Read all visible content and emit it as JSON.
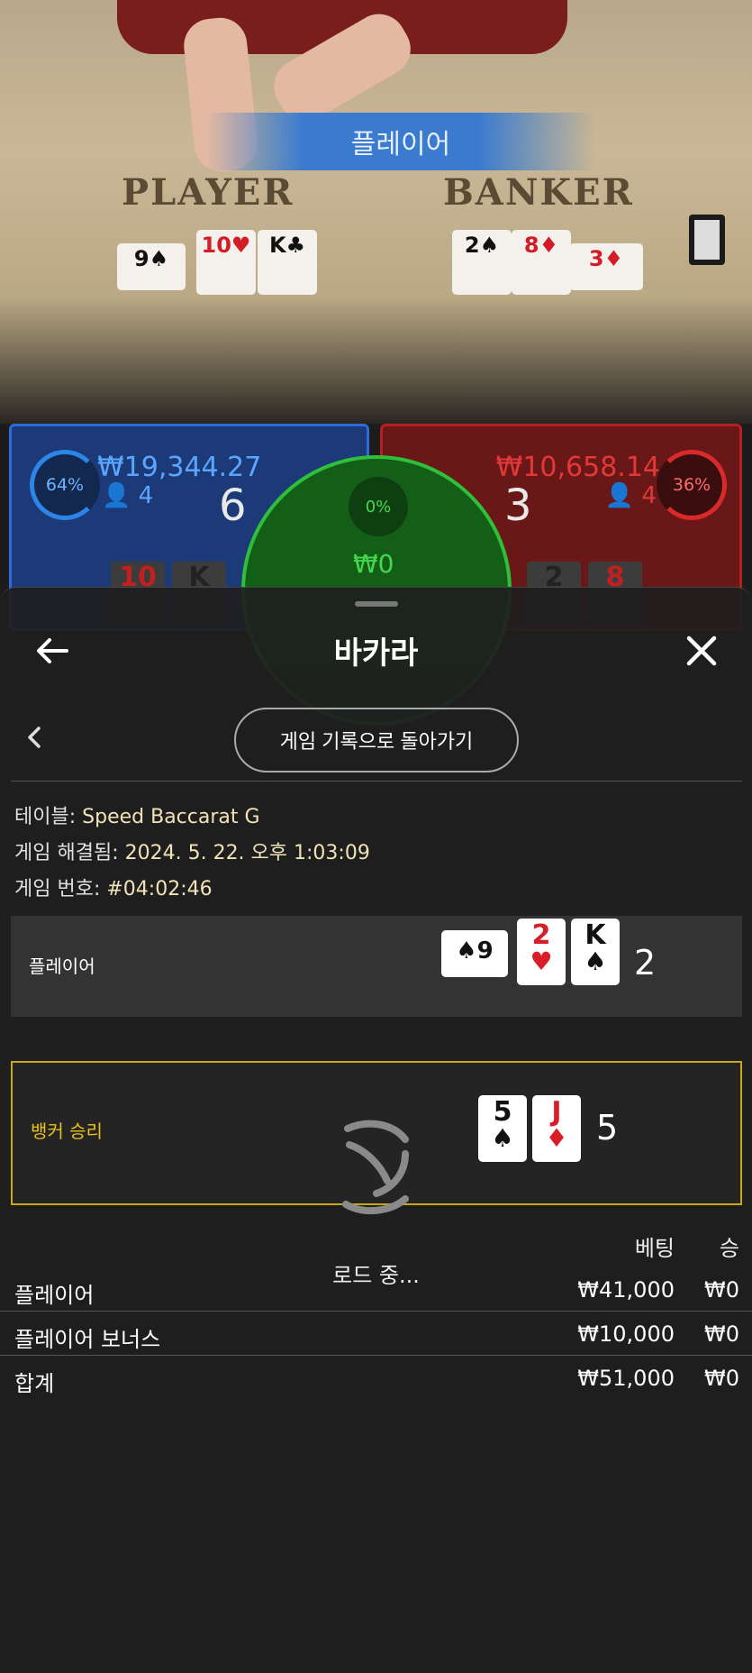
{
  "video": {
    "banner": "플레이어",
    "player_word": "PLAYER",
    "banker_word": "BANKER",
    "player_cards": [
      "9♠",
      "10♥",
      "K♣"
    ],
    "banker_cards": [
      "2♠",
      "8♦",
      "3♦"
    ]
  },
  "panels": {
    "player": {
      "percent": "64%",
      "amount": "₩19,344.27",
      "count": "4",
      "score": "6",
      "cards": [
        "10",
        "K"
      ]
    },
    "banker": {
      "percent": "36%",
      "amount": "₩10,658.14",
      "count": "4",
      "score": "3",
      "cards": [
        "2",
        "8"
      ]
    },
    "tie": {
      "percent": "0%",
      "amount": "₩0"
    }
  },
  "sheet": {
    "title": "바카라",
    "back_history_label": "게임 기록으로 돌아가기",
    "table_label": "테이블: ",
    "table_value": "Speed Baccarat G",
    "resolved_label": "게임 해결됨: ",
    "resolved_value": "2024. 5. 22. 오후 1:03:09",
    "game_no_label": "게임 번호: ",
    "game_no_value": "#04:02:46",
    "player_row": {
      "label": "플레이어",
      "cards": [
        {
          "rank": "9",
          "suit": "♠",
          "color": "black",
          "sideways": true
        },
        {
          "rank": "2",
          "suit": "♥",
          "color": "red"
        },
        {
          "rank": "K",
          "suit": "♠",
          "color": "black"
        }
      ],
      "score": "2"
    },
    "banker_row": {
      "label": "뱅커 승리",
      "cards": [
        {
          "rank": "5",
          "suit": "♠",
          "color": "black"
        },
        {
          "rank": "J",
          "suit": "♦",
          "color": "red"
        }
      ],
      "score": "5"
    },
    "loading": "로드 중...",
    "bets_header": {
      "bet": "베팅",
      "win": "승"
    },
    "bets": [
      {
        "name": "플레이어",
        "bet": "₩41,000",
        "win": "₩0"
      },
      {
        "name": "플레이어 보너스",
        "bet": "₩10,000",
        "win": "₩0"
      }
    ],
    "total": {
      "name": "합계",
      "bet": "₩51,000",
      "win": "₩0"
    }
  },
  "colors": {
    "accent_gold": "#c9a81a",
    "player_blue": "#2f6bd8",
    "banker_red": "#b52020",
    "tie_green": "#2fbf3a"
  },
  "icons": {
    "back": "arrow-left-icon",
    "close": "close-icon",
    "chevron": "chevron-left-icon",
    "loader": "spinner-icon"
  }
}
